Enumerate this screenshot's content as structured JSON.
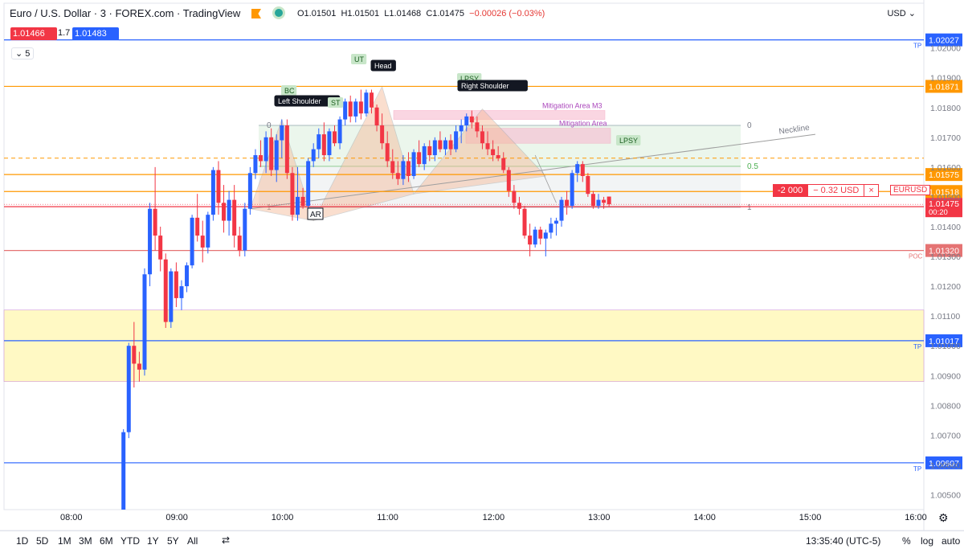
{
  "header": {
    "title": "Euro / U.S. Dollar · 3 · FOREX.com · TradingView",
    "open": "O1.01501",
    "high": "H1.01501",
    "low": "L1.01468",
    "close": "C1.01475",
    "change": "−0.00026 (−0.03%)"
  },
  "quote": {
    "bid": "1.01466",
    "spread": "1.7",
    "ask": "1.01483"
  },
  "indicators_toggle": "5",
  "currency": "USD",
  "order": {
    "qty": "-2 000",
    "pnl": "− 0.32 USD",
    "close": "×",
    "symbol": "EURUSD"
  },
  "bottom": {
    "timeframes": [
      "1D",
      "5D",
      "1M",
      "3M",
      "6M",
      "YTD",
      "1Y",
      "5Y",
      "All"
    ],
    "clock": "13:35:40 (UTC-5)",
    "percent": "%",
    "log": "log",
    "auto": "auto"
  },
  "colors": {
    "up": "#2962ff",
    "down": "#f23645",
    "orange": "#ff9800",
    "blue_line": "#2962ff",
    "poc": "#e57373",
    "mitigation": "#ab47bc"
  },
  "chart_data": {
    "type": "candlestick",
    "symbol": "EURUSD",
    "interval": "3",
    "ylim": [
      1.0045,
      1.0208
    ],
    "x_ticks": [
      "08:00",
      "09:00",
      "10:00",
      "11:00",
      "12:00",
      "13:00",
      "14:00",
      "15:00",
      "16:00"
    ],
    "y_ticks": [
      "1.02000",
      "1.01900",
      "1.01800",
      "1.01700",
      "1.01600",
      "1.01500",
      "1.01400",
      "1.01300",
      "1.01200",
      "1.01100",
      "1.01000",
      "1.00900",
      "1.00800",
      "1.00700",
      "1.00600",
      "1.00500"
    ],
    "last_price": {
      "value": 1.01475,
      "label": "1.01475",
      "countdown": "00:20"
    },
    "price_lines": [
      {
        "value": 1.02027,
        "label": "1.02027",
        "tag": "TP",
        "color": "#2962ff"
      },
      {
        "value": 1.01871,
        "label": "1.01871",
        "tag": "",
        "color": "#ff9800"
      },
      {
        "value": 1.01575,
        "label": "1.01575",
        "tag": "",
        "color": "#ff9800"
      },
      {
        "value": 1.01518,
        "label": "1.01518",
        "tag": "",
        "color": "#ff9800"
      },
      {
        "value": 1.01467,
        "label": "1.01467",
        "tag": "",
        "color": "#f23645"
      },
      {
        "value": 1.0132,
        "label": "1.01320",
        "tag": "POC",
        "color": "#e57373"
      },
      {
        "value": 1.01017,
        "label": "1.01017",
        "tag": "TP",
        "color": "#2962ff"
      },
      {
        "value": 1.00607,
        "label": "1.00607",
        "tag": "TP",
        "color": "#2962ff"
      }
    ],
    "dashed_level": 1.0163,
    "zones": [
      {
        "label": "",
        "from": 1.0088,
        "to": 1.0112,
        "color": "#fff9c4"
      },
      {
        "label": "Mitigation Area M3",
        "from": 1.0176,
        "to": 1.0179,
        "color": "#f8bbd0"
      },
      {
        "label": "Mitigation Area",
        "from": 1.0168,
        "to": 1.0173,
        "color": "#f8bbd0"
      }
    ],
    "fib": {
      "levels": [
        "0",
        "0.5",
        "1"
      ],
      "top": 1.0174,
      "bottom": 1.01465
    },
    "annotations": [
      "BC",
      "Left Shoulder",
      "ST",
      "UT",
      "Head",
      "LPSY",
      "Right Shoulder",
      "AR",
      "Neckline",
      "LPSY"
    ],
    "candles": [
      {
        "t": "08:30",
        "o": 1.0045,
        "h": 1.0072,
        "l": 1.0045,
        "c": 1.0071
      },
      {
        "t": "08:33",
        "o": 1.0071,
        "h": 1.0101,
        "l": 1.0069,
        "c": 1.01
      },
      {
        "t": "08:36",
        "o": 1.01,
        "h": 1.0108,
        "l": 1.0086,
        "c": 1.0094
      },
      {
        "t": "08:39",
        "o": 1.0094,
        "h": 1.0098,
        "l": 1.0088,
        "c": 1.0092
      },
      {
        "t": "08:42",
        "o": 1.0092,
        "h": 1.0126,
        "l": 1.009,
        "c": 1.0124
      },
      {
        "t": "08:45",
        "o": 1.0124,
        "h": 1.0148,
        "l": 1.012,
        "c": 1.0146
      },
      {
        "t": "08:48",
        "o": 1.0146,
        "h": 1.016,
        "l": 1.0132,
        "c": 1.0137
      },
      {
        "t": "08:51",
        "o": 1.0137,
        "h": 1.014,
        "l": 1.0125,
        "c": 1.0129
      },
      {
        "t": "08:54",
        "o": 1.0129,
        "h": 1.0131,
        "l": 1.0106,
        "c": 1.0108
      },
      {
        "t": "08:57",
        "o": 1.0108,
        "h": 1.0126,
        "l": 1.0106,
        "c": 1.0125
      },
      {
        "t": "09:00",
        "o": 1.0125,
        "h": 1.0128,
        "l": 1.0113,
        "c": 1.0116
      },
      {
        "t": "09:03",
        "o": 1.0116,
        "h": 1.0122,
        "l": 1.0112,
        "c": 1.012
      },
      {
        "t": "09:06",
        "o": 1.012,
        "h": 1.0128,
        "l": 1.0118,
        "c": 1.0127
      },
      {
        "t": "09:09",
        "o": 1.0127,
        "h": 1.0144,
        "l": 1.0126,
        "c": 1.0143
      },
      {
        "t": "09:12",
        "o": 1.0143,
        "h": 1.0151,
        "l": 1.0135,
        "c": 1.0137
      },
      {
        "t": "09:15",
        "o": 1.0137,
        "h": 1.0142,
        "l": 1.0128,
        "c": 1.0133
      },
      {
        "t": "09:18",
        "o": 1.0133,
        "h": 1.0145,
        "l": 1.0131,
        "c": 1.0144
      },
      {
        "t": "09:21",
        "o": 1.0144,
        "h": 1.016,
        "l": 1.0142,
        "c": 1.0159
      },
      {
        "t": "09:24",
        "o": 1.0159,
        "h": 1.0162,
        "l": 1.0144,
        "c": 1.0148
      },
      {
        "t": "09:27",
        "o": 1.0148,
        "h": 1.0154,
        "l": 1.0138,
        "c": 1.0142
      },
      {
        "t": "09:30",
        "o": 1.0142,
        "h": 1.0152,
        "l": 1.0137,
        "c": 1.0149
      },
      {
        "t": "09:33",
        "o": 1.0149,
        "h": 1.0154,
        "l": 1.0133,
        "c": 1.0137
      },
      {
        "t": "09:36",
        "o": 1.0137,
        "h": 1.014,
        "l": 1.013,
        "c": 1.0132
      },
      {
        "t": "09:39",
        "o": 1.0132,
        "h": 1.0148,
        "l": 1.013,
        "c": 1.0146
      },
      {
        "t": "09:42",
        "o": 1.0146,
        "h": 1.016,
        "l": 1.0144,
        "c": 1.0158
      },
      {
        "t": "09:45",
        "o": 1.0158,
        "h": 1.0166,
        "l": 1.0156,
        "c": 1.0164
      },
      {
        "t": "09:48",
        "o": 1.0164,
        "h": 1.0169,
        "l": 1.016,
        "c": 1.0162
      },
      {
        "t": "09:51",
        "o": 1.0162,
        "h": 1.0172,
        "l": 1.0158,
        "c": 1.017
      },
      {
        "t": "09:54",
        "o": 1.017,
        "h": 1.0173,
        "l": 1.0157,
        "c": 1.0159
      },
      {
        "t": "09:57",
        "o": 1.0159,
        "h": 1.0171,
        "l": 1.0155,
        "c": 1.0169
      },
      {
        "t": "10:00",
        "o": 1.0169,
        "h": 1.0176,
        "l": 1.0163,
        "c": 1.0174
      },
      {
        "t": "10:03",
        "o": 1.0174,
        "h": 1.0176,
        "l": 1.0156,
        "c": 1.0158
      },
      {
        "t": "10:06",
        "o": 1.0158,
        "h": 1.016,
        "l": 1.0142,
        "c": 1.0144
      },
      {
        "t": "10:09",
        "o": 1.0144,
        "h": 1.016,
        "l": 1.0142,
        "c": 1.015
      },
      {
        "t": "10:12",
        "o": 1.015,
        "h": 1.0153,
        "l": 1.0146,
        "c": 1.0147
      },
      {
        "t": "10:15",
        "o": 1.0147,
        "h": 1.0163,
        "l": 1.0145,
        "c": 1.0162
      },
      {
        "t": "10:18",
        "o": 1.0162,
        "h": 1.0168,
        "l": 1.016,
        "c": 1.0166
      },
      {
        "t": "10:21",
        "o": 1.0166,
        "h": 1.0173,
        "l": 1.0163,
        "c": 1.0171
      },
      {
        "t": "10:24",
        "o": 1.0171,
        "h": 1.0175,
        "l": 1.0162,
        "c": 1.0164
      },
      {
        "t": "10:27",
        "o": 1.0164,
        "h": 1.0173,
        "l": 1.0162,
        "c": 1.0172
      },
      {
        "t": "10:30",
        "o": 1.0172,
        "h": 1.0174,
        "l": 1.0167,
        "c": 1.0168
      },
      {
        "t": "10:33",
        "o": 1.0168,
        "h": 1.0177,
        "l": 1.0166,
        "c": 1.0176
      },
      {
        "t": "10:36",
        "o": 1.0176,
        "h": 1.0183,
        "l": 1.0174,
        "c": 1.0182
      },
      {
        "t": "10:39",
        "o": 1.0182,
        "h": 1.0184,
        "l": 1.0175,
        "c": 1.0177
      },
      {
        "t": "10:42",
        "o": 1.0177,
        "h": 1.0183,
        "l": 1.0175,
        "c": 1.0182
      },
      {
        "t": "10:45",
        "o": 1.0182,
        "h": 1.0186,
        "l": 1.0176,
        "c": 1.0178
      },
      {
        "t": "10:48",
        "o": 1.0178,
        "h": 1.0186,
        "l": 1.0177,
        "c": 1.0185
      },
      {
        "t": "10:51",
        "o": 1.0185,
        "h": 1.0186,
        "l": 1.0178,
        "c": 1.018
      },
      {
        "t": "10:54",
        "o": 1.018,
        "h": 1.0181,
        "l": 1.0172,
        "c": 1.0174
      },
      {
        "t": "10:57",
        "o": 1.0174,
        "h": 1.0178,
        "l": 1.0166,
        "c": 1.0168
      },
      {
        "t": "11:00",
        "o": 1.0168,
        "h": 1.0172,
        "l": 1.016,
        "c": 1.0162
      },
      {
        "t": "11:03",
        "o": 1.0162,
        "h": 1.0166,
        "l": 1.0156,
        "c": 1.0158
      },
      {
        "t": "11:06",
        "o": 1.0158,
        "h": 1.0162,
        "l": 1.0154,
        "c": 1.0156
      },
      {
        "t": "11:09",
        "o": 1.0156,
        "h": 1.0164,
        "l": 1.0154,
        "c": 1.0162
      },
      {
        "t": "11:12",
        "o": 1.0162,
        "h": 1.0165,
        "l": 1.0155,
        "c": 1.0157
      },
      {
        "t": "11:15",
        "o": 1.0157,
        "h": 1.0166,
        "l": 1.0156,
        "c": 1.0165
      },
      {
        "t": "11:18",
        "o": 1.0165,
        "h": 1.0169,
        "l": 1.016,
        "c": 1.0161
      },
      {
        "t": "11:21",
        "o": 1.0161,
        "h": 1.0168,
        "l": 1.0159,
        "c": 1.0167
      },
      {
        "t": "11:24",
        "o": 1.0167,
        "h": 1.0169,
        "l": 1.0162,
        "c": 1.0164
      },
      {
        "t": "11:27",
        "o": 1.0164,
        "h": 1.017,
        "l": 1.0162,
        "c": 1.0169
      },
      {
        "t": "11:30",
        "o": 1.0169,
        "h": 1.0172,
        "l": 1.0165,
        "c": 1.0166
      },
      {
        "t": "11:33",
        "o": 1.0166,
        "h": 1.017,
        "l": 1.0164,
        "c": 1.0169
      },
      {
        "t": "11:36",
        "o": 1.0169,
        "h": 1.0171,
        "l": 1.0164,
        "c": 1.0166
      },
      {
        "t": "11:39",
        "o": 1.0166,
        "h": 1.0174,
        "l": 1.0165,
        "c": 1.0172
      },
      {
        "t": "11:42",
        "o": 1.0172,
        "h": 1.0176,
        "l": 1.0168,
        "c": 1.0174
      },
      {
        "t": "11:45",
        "o": 1.0174,
        "h": 1.0178,
        "l": 1.0172,
        "c": 1.0177
      },
      {
        "t": "11:48",
        "o": 1.0177,
        "h": 1.0179,
        "l": 1.0173,
        "c": 1.0175
      },
      {
        "t": "11:51",
        "o": 1.0175,
        "h": 1.0177,
        "l": 1.017,
        "c": 1.0172
      },
      {
        "t": "11:54",
        "o": 1.0172,
        "h": 1.0174,
        "l": 1.0166,
        "c": 1.0168
      },
      {
        "t": "11:57",
        "o": 1.0168,
        "h": 1.0172,
        "l": 1.0164,
        "c": 1.0166
      },
      {
        "t": "12:00",
        "o": 1.0166,
        "h": 1.0169,
        "l": 1.0162,
        "c": 1.0164
      },
      {
        "t": "12:03",
        "o": 1.0164,
        "h": 1.0167,
        "l": 1.0162,
        "c": 1.0163
      },
      {
        "t": "12:06",
        "o": 1.0163,
        "h": 1.0165,
        "l": 1.0158,
        "c": 1.0159
      },
      {
        "t": "12:09",
        "o": 1.0159,
        "h": 1.016,
        "l": 1.015,
        "c": 1.0152
      },
      {
        "t": "12:12",
        "o": 1.0152,
        "h": 1.0154,
        "l": 1.0146,
        "c": 1.0148
      },
      {
        "t": "12:15",
        "o": 1.0148,
        "h": 1.015,
        "l": 1.0144,
        "c": 1.0146
      },
      {
        "t": "12:18",
        "o": 1.0146,
        "h": 1.0147,
        "l": 1.0136,
        "c": 1.0137
      },
      {
        "t": "12:21",
        "o": 1.0137,
        "h": 1.0141,
        "l": 1.013,
        "c": 1.0134
      },
      {
        "t": "12:24",
        "o": 1.0134,
        "h": 1.014,
        "l": 1.0133,
        "c": 1.0139
      },
      {
        "t": "12:27",
        "o": 1.0139,
        "h": 1.014,
        "l": 1.0134,
        "c": 1.0136
      },
      {
        "t": "12:30",
        "o": 1.0136,
        "h": 1.0139,
        "l": 1.013,
        "c": 1.0138
      },
      {
        "t": "12:33",
        "o": 1.0138,
        "h": 1.0143,
        "l": 1.0136,
        "c": 1.0141
      },
      {
        "t": "12:36",
        "o": 1.0141,
        "h": 1.0143,
        "l": 1.0137,
        "c": 1.0142
      },
      {
        "t": "12:39",
        "o": 1.0142,
        "h": 1.015,
        "l": 1.014,
        "c": 1.0149
      },
      {
        "t": "12:42",
        "o": 1.0149,
        "h": 1.0152,
        "l": 1.0144,
        "c": 1.0147
      },
      {
        "t": "12:45",
        "o": 1.0147,
        "h": 1.0159,
        "l": 1.0146,
        "c": 1.0158
      },
      {
        "t": "12:48",
        "o": 1.0158,
        "h": 1.0162,
        "l": 1.0155,
        "c": 1.0161
      },
      {
        "t": "12:51",
        "o": 1.0161,
        "h": 1.0162,
        "l": 1.0155,
        "c": 1.0157
      },
      {
        "t": "12:54",
        "o": 1.0157,
        "h": 1.0158,
        "l": 1.015,
        "c": 1.0151
      },
      {
        "t": "12:57",
        "o": 1.0151,
        "h": 1.0152,
        "l": 1.0146,
        "c": 1.0147
      },
      {
        "t": "13:00",
        "o": 1.0147,
        "h": 1.0151,
        "l": 1.0146,
        "c": 1.0149
      },
      {
        "t": "13:03",
        "o": 1.0149,
        "h": 1.015,
        "l": 1.0146,
        "c": 1.0148
      },
      {
        "t": "13:06",
        "o": 1.01501,
        "h": 1.01501,
        "l": 1.01468,
        "c": 1.01475
      }
    ]
  }
}
